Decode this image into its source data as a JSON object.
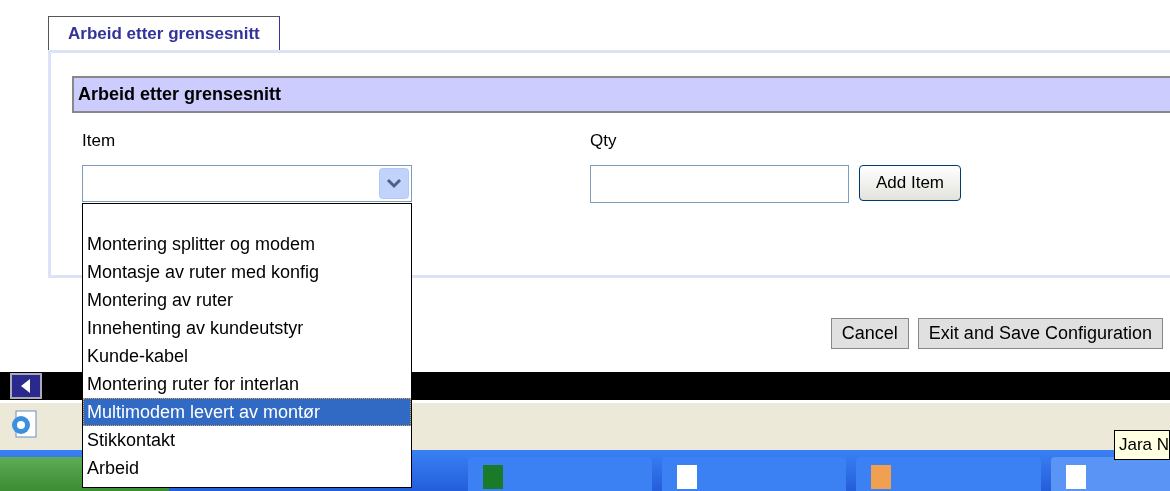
{
  "tab": {
    "label": "Arbeid etter grensesnitt",
    "selected": true
  },
  "section": {
    "title": "Arbeid etter grensesnitt"
  },
  "item_field": {
    "label": "Item",
    "expanded": true,
    "options": [
      {
        "label": "Montering splitter og modem",
        "selected": false
      },
      {
        "label": "Montasje av ruter med konfig",
        "selected": false
      },
      {
        "label": "Montering av ruter",
        "selected": false
      },
      {
        "label": "Innehenting av kundeutstyr",
        "selected": false
      },
      {
        "label": "Kunde-kabel",
        "selected": false
      },
      {
        "label": "Montering ruter for interlan",
        "selected": false
      },
      {
        "label": "Multimodem levert av montør",
        "selected": true
      },
      {
        "label": "Stikkontakt",
        "selected": false
      },
      {
        "label": "Arbeid",
        "selected": false
      }
    ]
  },
  "qty_field": {
    "label": "Qty"
  },
  "add_button": "Add Item",
  "footer_buttons": [
    "Cancel",
    "Exit and Save Configuration"
  ],
  "tooltip": "Jara N"
}
